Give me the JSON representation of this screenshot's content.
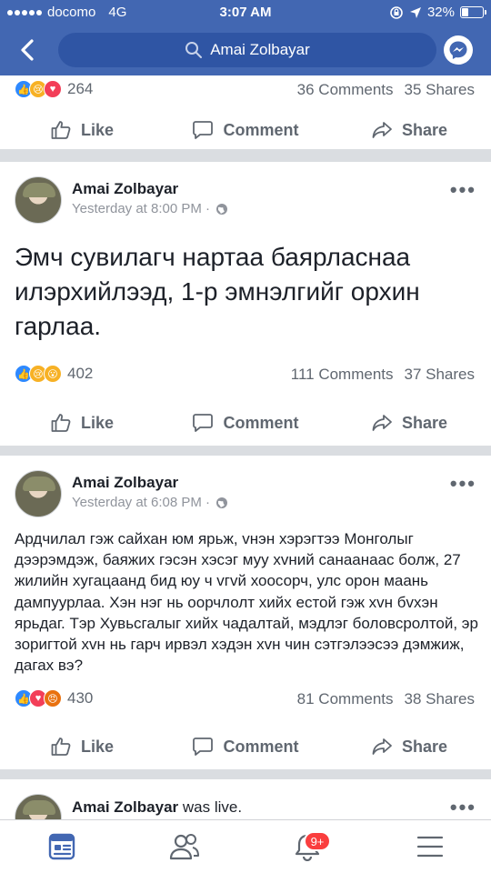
{
  "status_bar": {
    "carrier": "docomo",
    "network": "4G",
    "time": "3:07 AM",
    "battery": "32%",
    "battery_level": 0.32
  },
  "header": {
    "search_text": "Amai Zolbayar",
    "icons": [
      "back-icon",
      "search-icon",
      "messenger-icon"
    ]
  },
  "posts": [
    {
      "reactions": [
        "like",
        "sad",
        "love"
      ],
      "reaction_count": "264",
      "comments": "36 Comments",
      "shares": "35 Shares"
    },
    {
      "author": "Amai Zolbayar",
      "time": "Yesterday at 8:00 PM · ",
      "text": "Эмч сувилагч нартаа баярласнаа илэрхийлээд, 1-р эмнэлгийг орхин гарлаа.",
      "reactions": [
        "like",
        "sad",
        "wow"
      ],
      "reaction_count": "402",
      "comments": "111 Comments",
      "shares": "37 Shares"
    },
    {
      "author": "Amai Zolbayar",
      "time": "Yesterday at 6:08 PM · ",
      "text": "Ардчилал гэж сайхан юм ярьж, vнэн хэрэгтээ Монголыг дээрэмдэж, баяжих гэсэн хэсэг муу хvний санаанаас болж, 27 жилийн хугацаанд бид юу ч vгvй хоосорч, улс орон маань дампуурлаа. Хэн нэг нь оорчлолт хийх естой гэж хvн бvхэн ярьдаг. Тэр Хувьсгалыг хийх чадалтай, мэдлэг боловсролтой, эр зоригтой хvн нь гарч ирвэл хэдэн хvн чин сэтгэлээсээ дэмжиж, дагах вэ?",
      "reactions": [
        "like",
        "love",
        "angry"
      ],
      "reaction_count": "430",
      "comments": "81 Comments",
      "shares": "38 Shares"
    },
    {
      "author": "Amai Zolbayar",
      "live_text": " was live."
    }
  ],
  "actions": {
    "like": "Like",
    "comment": "Comment",
    "share": "Share"
  },
  "tabbar": {
    "tabs": [
      "news-feed-icon",
      "friends-icon",
      "notifications-icon",
      "menu-icon"
    ],
    "notification_badge": "9+"
  },
  "colors": {
    "brand": "#4267b2",
    "search_bg": "#2f55a4",
    "badge": "#fa3e3e",
    "active_tab": "#4267b2"
  }
}
